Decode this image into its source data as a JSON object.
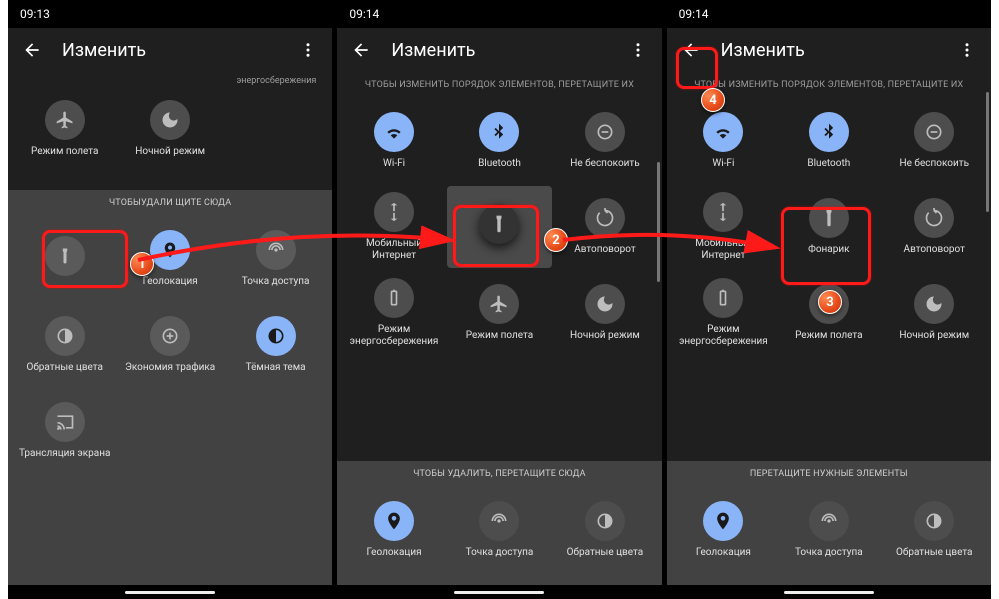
{
  "colors": {
    "accent": "#8ab4f8",
    "bg": "#1f1f1f",
    "dim": "#424242"
  },
  "screens": [
    {
      "time": "09:13",
      "header": {
        "title": "Изменить"
      },
      "preText": "энергосбережения",
      "topTiles": [
        {
          "icon": "airplane",
          "label": "Режим полета",
          "active": false
        },
        {
          "icon": "moon",
          "label": "Ночной режим",
          "active": false
        }
      ],
      "dimInstruction": "ЧТОБЫуДАЛИ        ЩИТЕ СЮДА",
      "dimTiles": [
        {
          "icon": "flashlight",
          "label": "",
          "active": false,
          "row": 0,
          "col": 0
        },
        {
          "icon": "location",
          "label": "Геолокация",
          "active": true,
          "row": 0,
          "col": 1
        },
        {
          "icon": "hotspot",
          "label": "Точка доступа",
          "active": false,
          "row": 0,
          "col": 2
        },
        {
          "icon": "invert",
          "label": "Обратные цвета",
          "active": false,
          "row": 1,
          "col": 0
        },
        {
          "icon": "datasaver",
          "label": "Экономия трафика",
          "active": false,
          "row": 1,
          "col": 1
        },
        {
          "icon": "darktheme",
          "label": "Тёмная тема",
          "active": true,
          "row": 1,
          "col": 2
        },
        {
          "icon": "cast",
          "label": "Трансляция экрана",
          "active": false,
          "row": 2,
          "col": 0
        }
      ]
    },
    {
      "time": "09:14",
      "header": {
        "title": "Изменить"
      },
      "instruction": "ЧТОБЫ ИЗМЕНИТЬ ПОРЯДОК ЭЛЕМЕНТОВ, ПЕРЕТАЩИТЕ ИХ",
      "tiles": [
        {
          "icon": "wifi",
          "label": "Wi-Fi",
          "active": true
        },
        {
          "icon": "bluetooth",
          "label": "Bluetooth",
          "active": true
        },
        {
          "icon": "dnd",
          "label": "Не беспокоить",
          "active": false
        },
        {
          "icon": "data",
          "label": "Мобильный Интернет",
          "active": false
        },
        {
          "icon": "flashlight",
          "label": "",
          "active": false,
          "dragging": true
        },
        {
          "icon": "rotate",
          "label": "Автоповорот",
          "active": false
        },
        {
          "icon": "battery",
          "label": "Режим энергосбережения",
          "active": false
        },
        {
          "icon": "airplane",
          "label": "Режим полета",
          "active": false
        },
        {
          "icon": "moon",
          "label": "Ночной режим",
          "active": false
        }
      ],
      "dimInstruction": "ЧТОБЫ УДАЛИТЬ, ПЕРЕТАЩИТЕ СЮДА",
      "dimTiles": [
        {
          "icon": "location",
          "label": "Геолокация",
          "active": true
        },
        {
          "icon": "hotspot",
          "label": "Точка доступа",
          "active": false
        },
        {
          "icon": "invert",
          "label": "Обратные цвета",
          "active": false
        }
      ]
    },
    {
      "time": "09:14",
      "header": {
        "title": "Изменить"
      },
      "instruction": "ЧТОБЫ ИЗМЕНИТЬ ПОРЯДОК ЭЛЕМЕНТОВ, ПЕРЕТАЩИТЕ ИХ",
      "tiles": [
        {
          "icon": "wifi",
          "label": "Wi-Fi",
          "active": true
        },
        {
          "icon": "bluetooth",
          "label": "Bluetooth",
          "active": true
        },
        {
          "icon": "dnd",
          "label": "Не беспокоить",
          "active": false
        },
        {
          "icon": "data",
          "label": "Мобильный Интернет",
          "active": false
        },
        {
          "icon": "flashlight",
          "label": "Фонарик",
          "active": false
        },
        {
          "icon": "rotate",
          "label": "Автоповорот",
          "active": false
        },
        {
          "icon": "battery",
          "label": "Режим энергосбережения",
          "active": false
        },
        {
          "icon": "airplane",
          "label": "Режим полета",
          "active": false
        },
        {
          "icon": "moon",
          "label": "Ночной режим",
          "active": false
        }
      ],
      "dimInstruction": "ПЕРЕТАЩИТЕ НУЖНЫЕ ЭЛЕМЕНТЫ",
      "dimTiles": [
        {
          "icon": "location",
          "label": "Геолокация",
          "active": true
        },
        {
          "icon": "hotspot",
          "label": "Точка доступа",
          "active": false
        },
        {
          "icon": "invert",
          "label": "Обратные цвета",
          "active": false
        }
      ]
    }
  ],
  "annotations": {
    "badges": [
      "1",
      "2",
      "3",
      "4"
    ]
  }
}
